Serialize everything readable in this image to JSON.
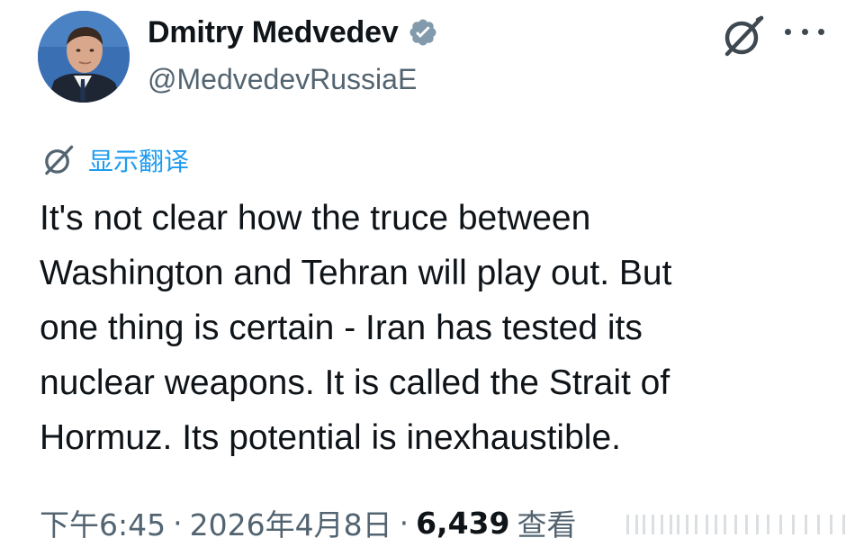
{
  "author": {
    "display_name": "Dmitry Medvedev",
    "handle": "@MedvedevRussiaE",
    "verified": true
  },
  "icons": {
    "avatar": "profile-photo",
    "verified": "verified-badge-icon",
    "grok": "grok-icon",
    "more": "more-horizontal-icon",
    "translate": "grok-translate-icon"
  },
  "translate": {
    "label": "显示翻译"
  },
  "tweet": {
    "lines": [
      "It's not clear how the truce between",
      "Washington and Tehran will play out. But",
      "one thing is certain - Iran has tested its",
      "nuclear weapons. It is called the Strait of",
      "Hormuz. Its potential is inexhaustible."
    ]
  },
  "meta": {
    "time": "下午6:45",
    "separator": "·",
    "date": "2026年4月8日",
    "views_count": "6,439",
    "views_label": "查看"
  },
  "colors": {
    "text": "#0f1419",
    "secondary": "#536471",
    "link": "#1d9bf0",
    "verified_badge": "#829aab"
  }
}
